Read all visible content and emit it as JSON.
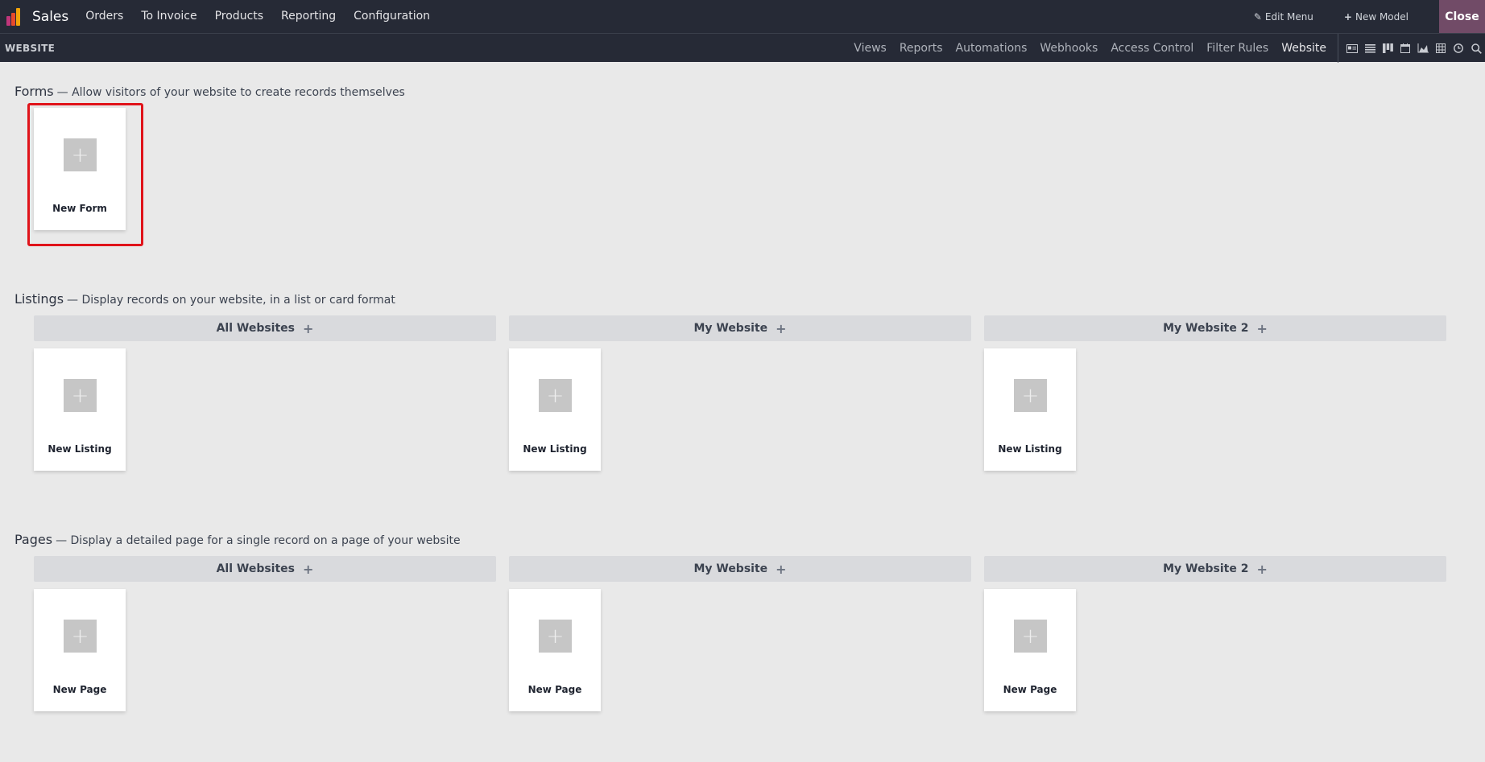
{
  "app": {
    "name": "Sales",
    "logo_colors": [
      "#c0367b",
      "#f2a40a",
      "#e84a2c"
    ]
  },
  "nav": [
    "Orders",
    "To Invoice",
    "Products",
    "Reporting",
    "Configuration"
  ],
  "top_right": {
    "edit_menu": "Edit Menu",
    "new_model": "New Model",
    "close": "Close"
  },
  "subbar": {
    "title": "WEBSITE",
    "links": [
      "Views",
      "Reports",
      "Automations",
      "Webhooks",
      "Access Control",
      "Filter Rules",
      "Website"
    ],
    "view_icons": [
      "form-view-icon",
      "list-view-icon",
      "kanban-view-icon",
      "calendar-view-icon",
      "graph-view-icon",
      "pivot-view-icon",
      "activity-view-icon",
      "search-icon"
    ]
  },
  "forms": {
    "title": "Forms",
    "desc": "— Allow visitors of your website to create records themselves",
    "card_label": "New Form"
  },
  "listings": {
    "title": "Listings",
    "desc": "— Display records on your website, in a list or card format",
    "columns": [
      "All Websites",
      "My Website",
      "My Website 2"
    ],
    "card_label": "New Listing"
  },
  "pages": {
    "title": "Pages",
    "desc": "— Display a detailed page for a single record on a page of your website",
    "columns": [
      "All Websites",
      "My Website",
      "My Website 2"
    ],
    "card_label": "New Page"
  },
  "colors": {
    "accent": "#714b67",
    "highlight": "#e0131a",
    "navbar": "#262a36"
  }
}
